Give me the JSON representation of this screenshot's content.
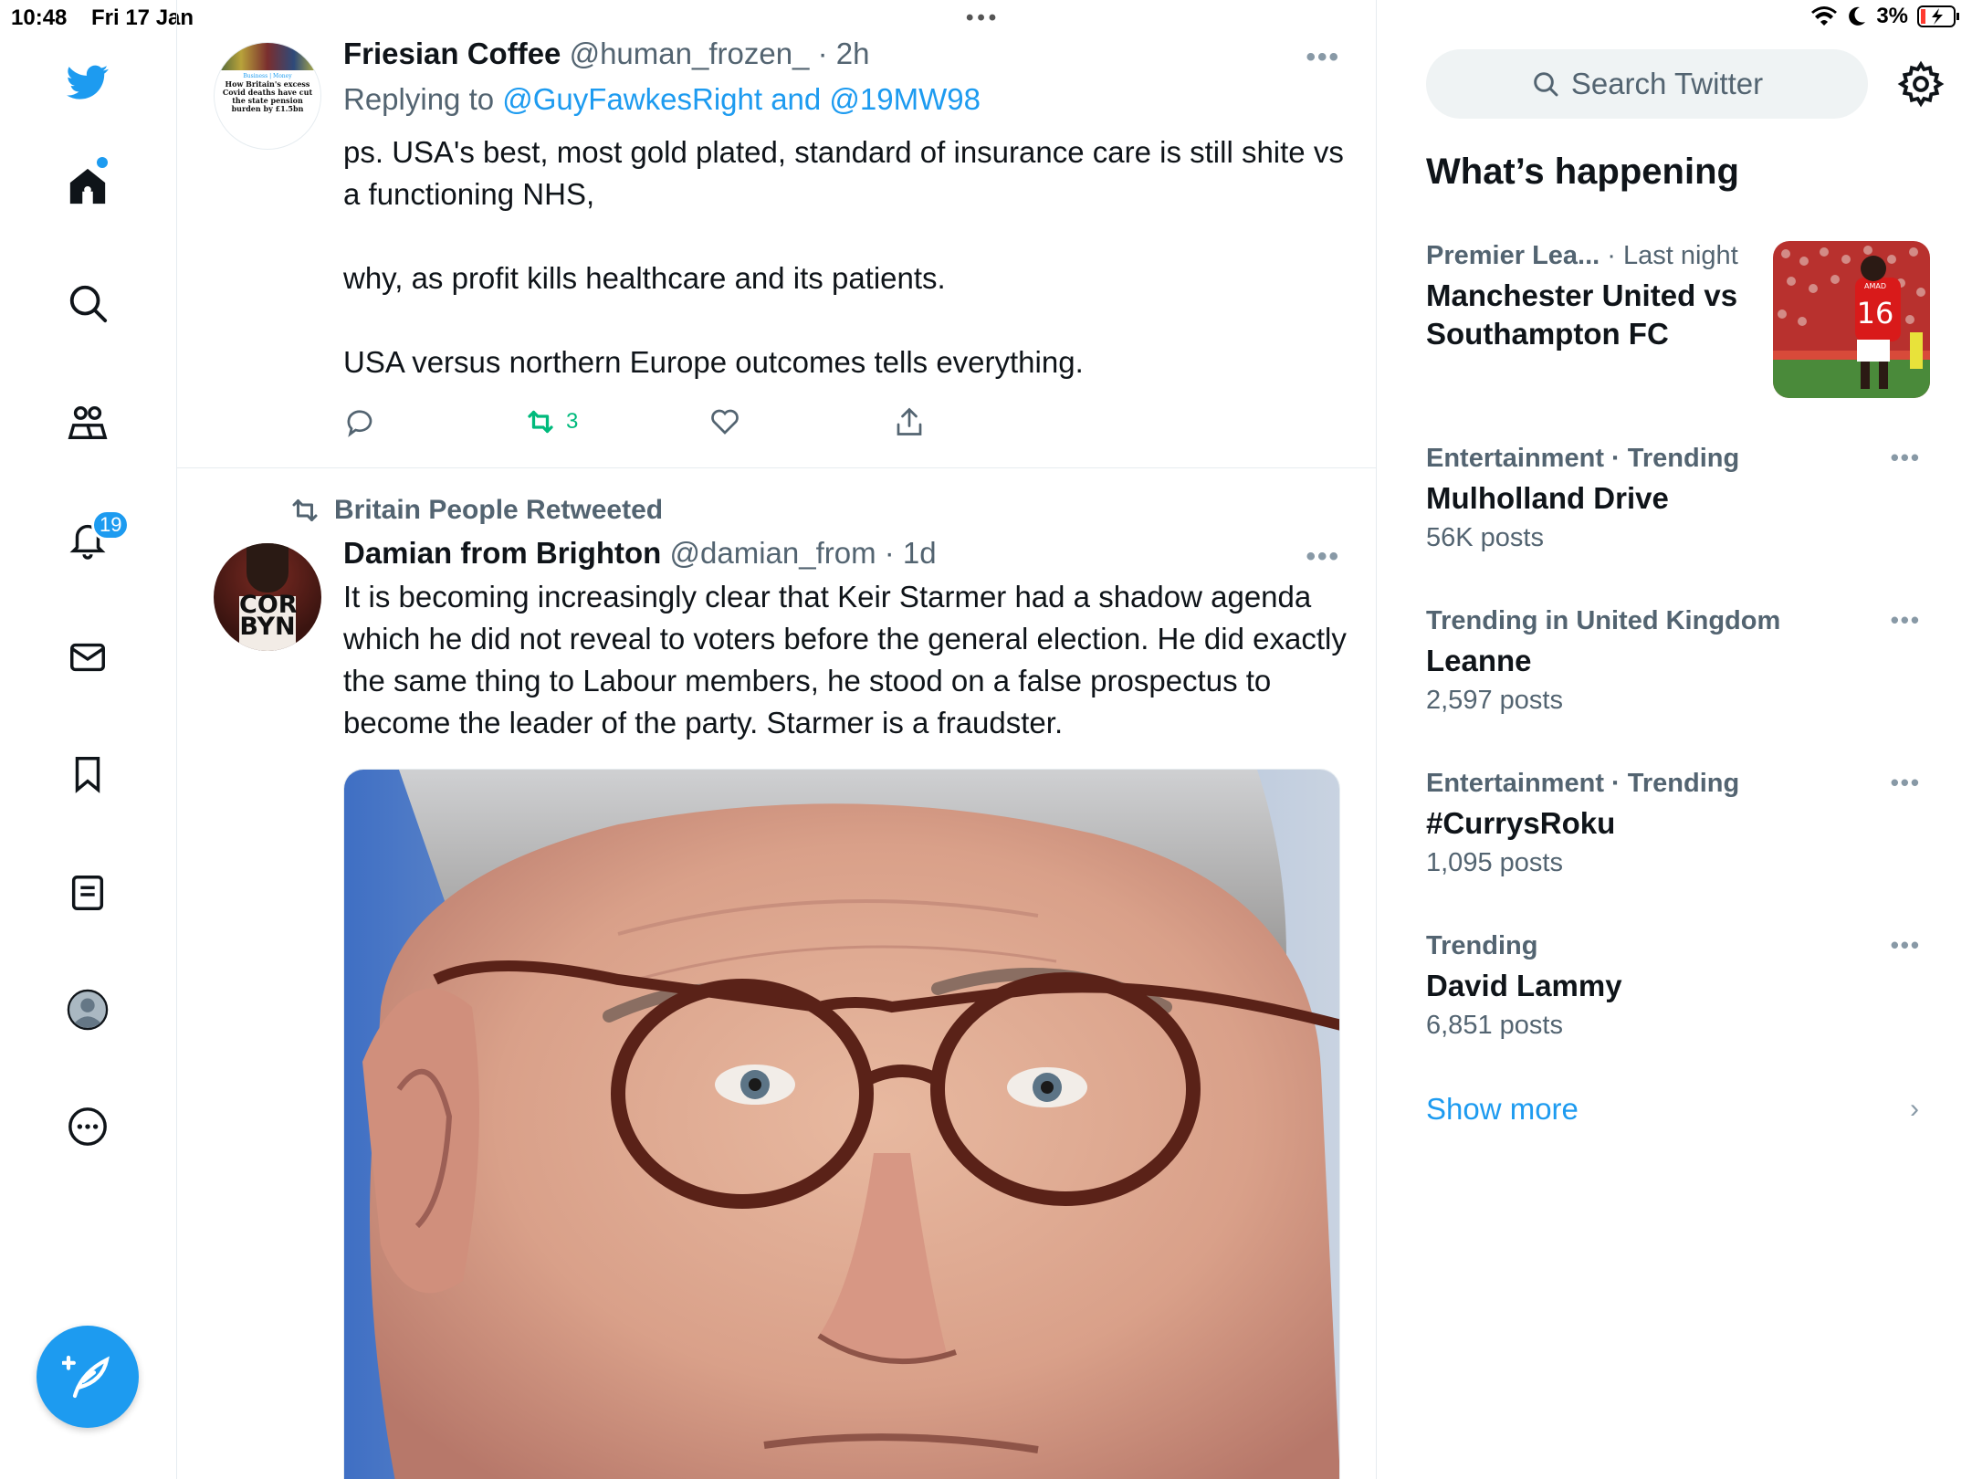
{
  "status_bar": {
    "time": "10:48",
    "date": "Fri 17 Jan",
    "battery": "3%"
  },
  "nav": {
    "notification_count": "19",
    "items": [
      "twitter-logo",
      "home",
      "explore",
      "communities",
      "notifications",
      "messages",
      "bookmarks",
      "lists",
      "profile",
      "more"
    ]
  },
  "tweets": [
    {
      "name": "Friesian Coffee",
      "meta": "@human_frozen_ · 2h",
      "reply_prefix": "Replying to ",
      "reply_to": "@GuyFawkesRight and @19MW98",
      "avatar_text": [
        "Business | Money",
        "How Britain's excess",
        "Covid deaths have cut",
        "the state pension",
        "burden by £1.5bn"
      ],
      "paragraphs": [
        "ps. USA's best, most gold plated, standard of insurance care is still shite vs a functioning NHS,",
        "why, as profit kills healthcare and its patients.",
        "USA versus northern Europe outcomes tells everything."
      ],
      "retweet_count": "3"
    },
    {
      "retweeted_by": "Britain People Retweeted",
      "name": "Damian from Brighton",
      "meta": "@damian_from · 1d",
      "avatar_text": [
        "COR",
        "BYN"
      ],
      "text": "It is becoming increasingly clear that Keir Starmer had a shadow agenda which he did not reveal to voters before the general election. He did exactly the same thing to Labour members, he stood on a false prospectus to become the leader of the party. Starmer is a fraudster."
    }
  ],
  "sidebar": {
    "search_placeholder": "Search Twitter",
    "heading": "What’s happening",
    "trends": [
      {
        "category": "Premier Lea...",
        "category_extra": " · Last night",
        "title": "Manchester United vs Southampton FC",
        "count": ""
      },
      {
        "category": "Entertainment · Trending",
        "category_extra": "",
        "title": "Mulholland Drive",
        "count": "56K posts"
      },
      {
        "category": "Trending in United Kingdom",
        "category_extra": "",
        "title": "Leanne",
        "count": "2,597 posts"
      },
      {
        "category": "Entertainment · Trending",
        "category_extra": "",
        "title": "#CurrysRoku",
        "count": "1,095 posts"
      },
      {
        "category": "Trending",
        "category_extra": "",
        "title": "David Lammy",
        "count": "6,851 posts"
      }
    ],
    "trend_image_text": [
      "AMAD",
      "16"
    ],
    "show_more": "Show more"
  },
  "colors": {
    "accent": "#1d9bf0",
    "retweet_green": "#00ba7c",
    "secondary_text": "#536471"
  }
}
